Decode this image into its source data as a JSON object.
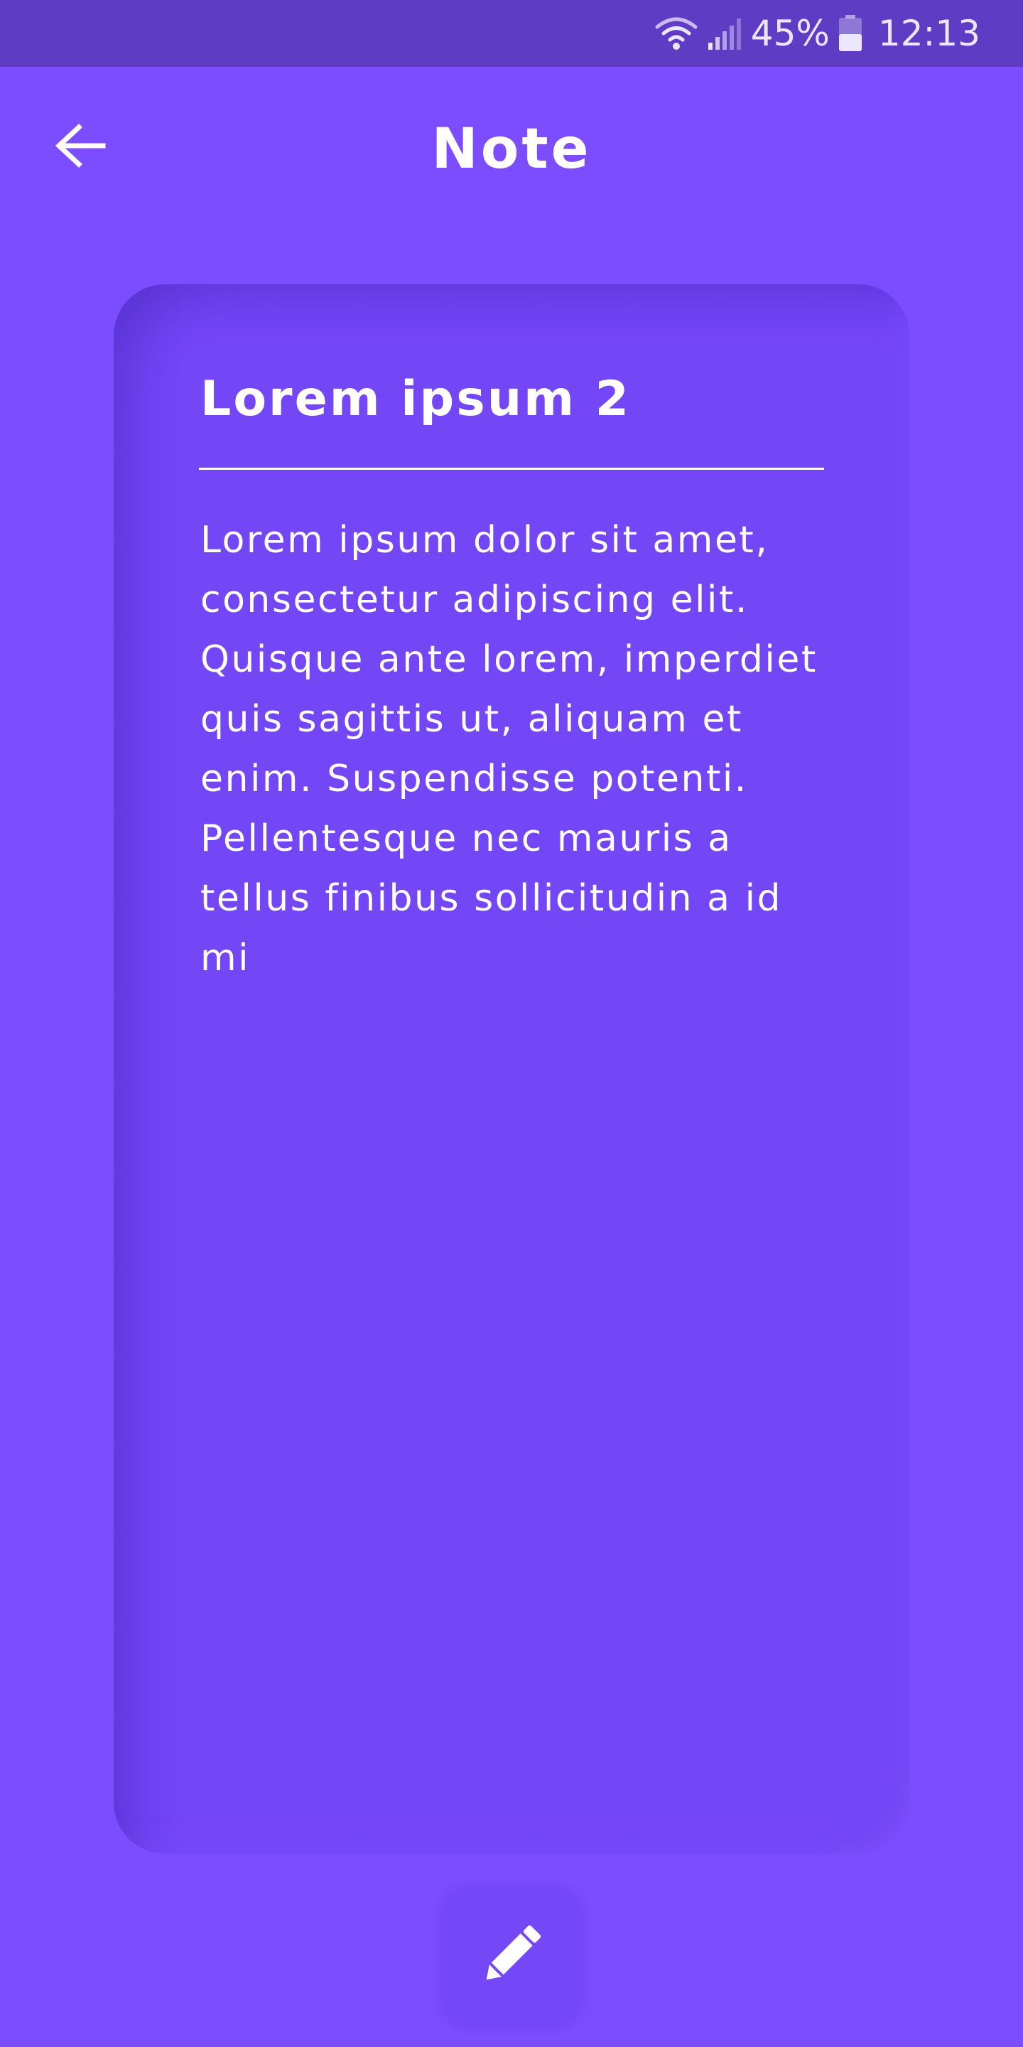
{
  "status_bar": {
    "battery_percent": "45%",
    "time": "12:13",
    "icons": [
      "wifi-icon",
      "signal-icon",
      "battery-icon"
    ]
  },
  "header": {
    "title": "Note",
    "back_icon": "arrow-left-icon"
  },
  "note": {
    "title": "Lorem ipsum 2",
    "body": "Lorem ipsum dolor sit amet,\nconsectetur adipiscing elit.\nQuisque ante lorem, imperdiet\nquis sagittis ut, aliquam et\nenim. Suspendisse potenti.\nPellentesque nec mauris a\ntellus finibus sollicitudin a id\nmi"
  },
  "actions": {
    "edit_icon": "pencil-icon"
  },
  "colors": {
    "background": "#7c4dff",
    "status_bar": "#5e3dc4",
    "card": "#7346f6",
    "text": "#ffffff"
  }
}
